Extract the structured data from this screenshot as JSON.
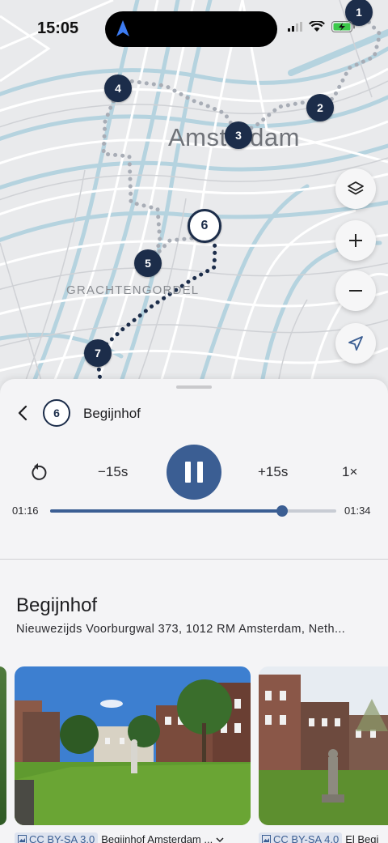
{
  "status_bar": {
    "time": "15:05"
  },
  "map": {
    "city_label": "Amsterdam",
    "district_label": "GRACHTENGORDEL",
    "markers": [
      {
        "label": "1"
      },
      {
        "label": "2"
      },
      {
        "label": "3"
      },
      {
        "label": "4"
      },
      {
        "label": "5"
      },
      {
        "label": "6",
        "active": true
      },
      {
        "label": "7"
      }
    ],
    "controls": [
      "layers-icon",
      "zoom-in-icon",
      "zoom-out-icon",
      "locate-icon"
    ]
  },
  "player": {
    "stop_number": "6",
    "stop_title": "Begijnhof",
    "rewind_label": "−15s",
    "forward_label": "+15s",
    "speed_label": "1×",
    "elapsed": "01:16",
    "total": "01:34",
    "progress": 0.81
  },
  "place": {
    "title": "Begijnhof",
    "address": "Nieuwezijds Voorburgwal 373, 1012 RM Amsterdam, Neth..."
  },
  "gallery": [
    {
      "license": "CC BY-SA 3.0",
      "caption": "Begijnhof Amsterdam ..."
    },
    {
      "license": "CC BY-SA 4.0",
      "caption": "El Begi"
    }
  ],
  "colors": {
    "accent": "#3b5e93",
    "marker": "#1c2d4a"
  }
}
